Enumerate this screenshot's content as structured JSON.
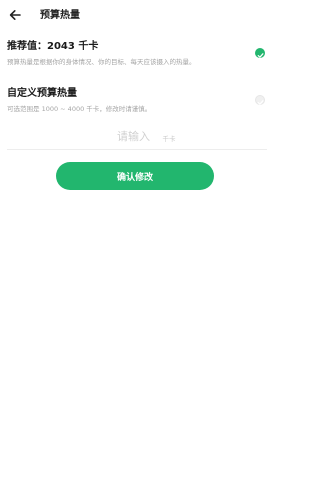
{
  "header": {
    "title": "预算热量",
    "back_icon": "arrow-left-icon"
  },
  "options": [
    {
      "title": "推荐值：2043 千卡",
      "description": "预算热量是根据你的身体情况、你的目标、每天应该摄入的热量。",
      "selected": true
    },
    {
      "title": "自定义预算热量",
      "description": "可选范围是 1000 ~ 4000 千卡，修改时请谨慎。",
      "selected": false
    }
  ],
  "input": {
    "value": "",
    "placeholder": "请输入",
    "unit": "千卡"
  },
  "confirm_button": {
    "label": "确认修改"
  },
  "colors": {
    "accent": "#22b66e",
    "muted_text": "#a5a5a5",
    "placeholder": "#d0d0d0"
  }
}
